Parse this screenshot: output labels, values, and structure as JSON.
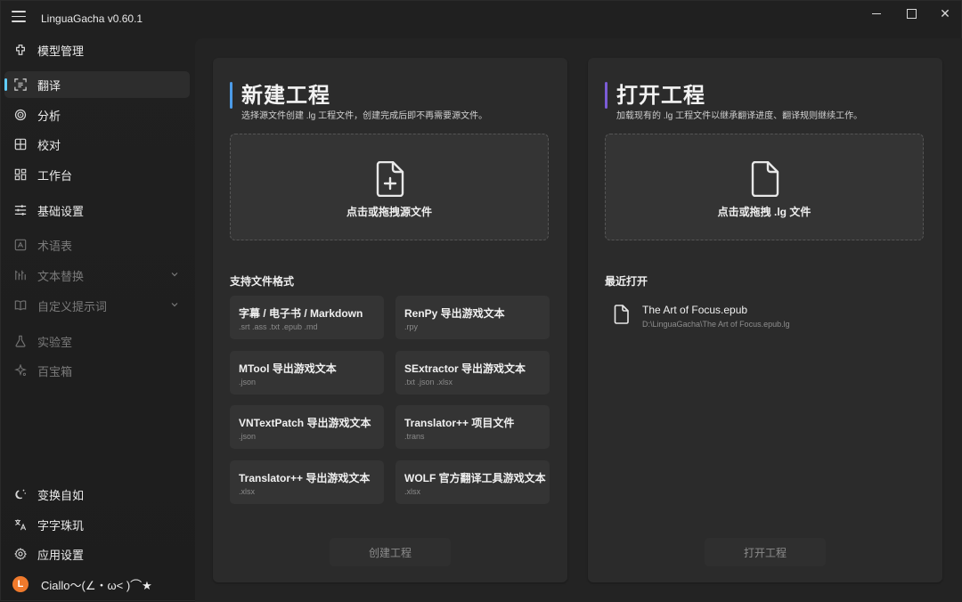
{
  "app": {
    "title": "LinguaGacha v0.60.1"
  },
  "colors": {
    "accent": "#60cdff",
    "new_project_accent": "#4c9be8",
    "open_project_accent": "#7b5cd6",
    "avatar": "#f07a2c"
  },
  "sidebar": {
    "top_items": [
      {
        "label": "模型管理",
        "icon": "model-icon",
        "state": "normal"
      },
      {
        "label": "翻译",
        "icon": "translate-icon",
        "state": "active"
      },
      {
        "label": "分析",
        "icon": "analysis-icon",
        "state": "normal"
      },
      {
        "label": "校对",
        "icon": "proofread-icon",
        "state": "normal"
      },
      {
        "label": "工作台",
        "icon": "workbench-icon",
        "state": "normal"
      },
      {
        "label": "基础设置",
        "icon": "settings-sliders-icon",
        "state": "normal"
      },
      {
        "label": "术语表",
        "icon": "glossary-icon",
        "state": "disabled"
      },
      {
        "label": "文本替换",
        "icon": "text-replace-icon",
        "state": "disabled",
        "expandable": true
      },
      {
        "label": "自定义提示词",
        "icon": "prompt-book-icon",
        "state": "disabled",
        "expandable": true
      },
      {
        "label": "实验室",
        "icon": "lab-flask-icon",
        "state": "disabled"
      },
      {
        "label": "百宝箱",
        "icon": "toolbox-icon",
        "state": "disabled"
      }
    ],
    "bottom_items": [
      {
        "label": "变换自如",
        "icon": "theme-toggle-icon"
      },
      {
        "label": "字字珠玑",
        "icon": "language-icon"
      },
      {
        "label": "应用设置",
        "icon": "gear-icon"
      }
    ],
    "user": {
      "avatar_letter": "L",
      "name": "Ciallo～(∠・ω< )⌒★"
    }
  },
  "new_project": {
    "title": "新建工程",
    "subtitle": "选择源文件创建 .lg 工程文件，创建完成后即不再需要源文件。",
    "drop_label": "点击或拖拽源文件",
    "formats_title": "支持文件格式",
    "formats": [
      {
        "title": "字幕 / 电子书 / Markdown",
        "ext": ".srt .ass .txt .epub .md"
      },
      {
        "title": "RenPy 导出游戏文本",
        "ext": ".rpy"
      },
      {
        "title": "MTool 导出游戏文本",
        "ext": ".json"
      },
      {
        "title": "SExtractor 导出游戏文本",
        "ext": ".txt .json .xlsx"
      },
      {
        "title": "VNTextPatch 导出游戏文本",
        "ext": ".json"
      },
      {
        "title": "Translator++ 项目文件",
        "ext": ".trans"
      },
      {
        "title": "Translator++ 导出游戏文本",
        "ext": ".xlsx"
      },
      {
        "title": "WOLF 官方翻译工具游戏文本",
        "ext": ".xlsx"
      }
    ],
    "create_button": "创建工程"
  },
  "open_project": {
    "title": "打开工程",
    "subtitle": "加载现有的 .lg 工程文件以继承翻译进度、翻译规则继续工作。",
    "drop_label": "点击或拖拽 .lg 文件",
    "recent_title": "最近打开",
    "recent": [
      {
        "name": "The Art of Focus.epub",
        "path": "D:\\LinguaGacha\\The Art of Focus.epub.lg"
      }
    ],
    "open_button": "打开工程"
  }
}
